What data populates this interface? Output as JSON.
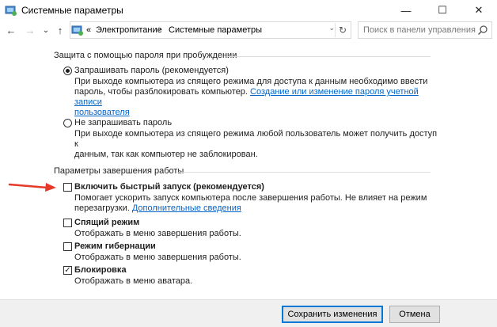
{
  "window": {
    "title": "Системные параметры",
    "minimize_glyph": "—",
    "maximize_glyph": "☐",
    "close_glyph": "✕"
  },
  "nav": {
    "back_glyph": "←",
    "forward_glyph": "→",
    "history_glyph": "⌄",
    "up_glyph": "↑"
  },
  "address": {
    "overflow": "«",
    "crumbs": [
      "Электропитание",
      "Системные параметры"
    ],
    "separator": "›",
    "dropdown_glyph": "⌄",
    "refresh_glyph": "↻"
  },
  "search": {
    "placeholder": "Поиск в панели управления"
  },
  "wake_password": {
    "title": "Защита с помощью пароля при пробуждении",
    "require": {
      "label": "Запрашивать пароль (рекомендуется)",
      "desc_line1": "При выходе компьютера из спящего режима для доступа к данным необходимо ввести",
      "desc_line2": "пароль, чтобы разблокировать компьютер. ",
      "link_line2": "Создание или изменение пароля учетной записи",
      "link_line3": "пользователя",
      "checked": true
    },
    "dont_require": {
      "label": "Не запрашивать пароль",
      "desc_line1": "При выходе компьютера из спящего режима любой пользователь может получить доступ к",
      "desc_line2": "данным, так как компьютер не заблокирован.",
      "checked": false
    }
  },
  "shutdown": {
    "title": "Параметры завершения работы",
    "fast_startup": {
      "label": "Включить быстрый запуск (рекомендуется)",
      "desc_line1": "Помогает ускорить запуск компьютера после завершения работы. Не влияет на режим",
      "desc_line2": "перезагрузки. ",
      "link": "Дополнительные сведения",
      "checked": false
    },
    "sleep": {
      "label": "Спящий режим",
      "desc": "Отображать в меню завершения работы.",
      "checked": false
    },
    "hibernate": {
      "label": "Режим гибернации",
      "desc": "Отображать в меню завершения работы.",
      "checked": false
    },
    "lock": {
      "label": "Блокировка",
      "desc": "Отображать в меню аватара.",
      "checked": true,
      "check_glyph": "✓"
    }
  },
  "footer": {
    "save_label": "Сохранить изменения",
    "cancel_label": "Отмена"
  },
  "colors": {
    "link": "#0066cc",
    "arrow": "#e53a2a",
    "primary_border": "#0078d7"
  }
}
